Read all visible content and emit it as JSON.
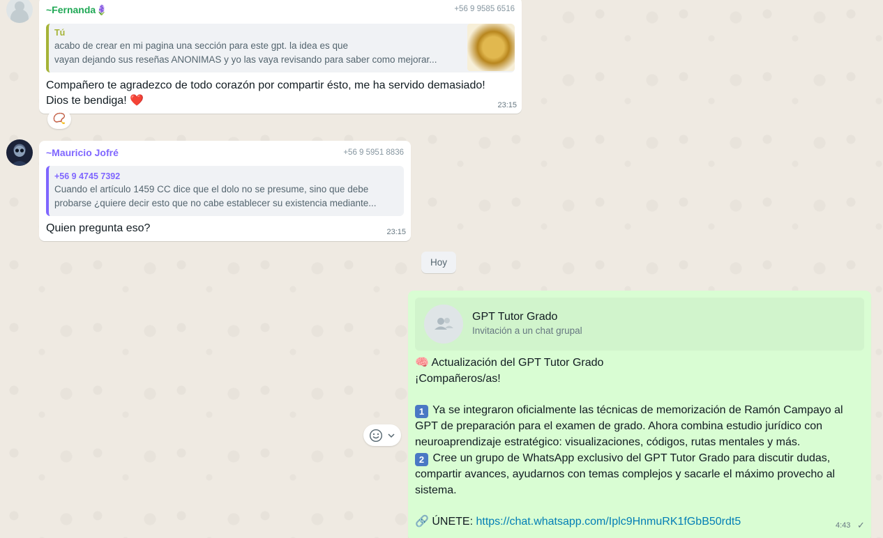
{
  "messages": [
    {
      "sender": "~Fernanda🪻",
      "phone": "+56 9 9585 6516",
      "quote_name": "Tú",
      "quote_line1": "acabo de crear en mi pagina una sección para este gpt. la idea es que",
      "quote_line2": "vayan dejando sus reseñas ANONIMAS y yo las vaya revisando para saber como mejorar...",
      "text_line1": "Compañero te agradezco de todo corazón por compartir ésto, me ha servido demasiado!",
      "text_line2": "Dios te bendiga! ❤️",
      "time": "23:15",
      "reaction": "📿"
    },
    {
      "sender": "~Mauricio Jofré",
      "phone": "+56 9 5951 8836",
      "quote_name": "+56 9 4745 7392",
      "quote_line1": "Cuando el artículo 1459 CC dice que el dolo no se presume, sino que debe",
      "quote_line2": "probarse ¿quiere decir esto que no cabe establecer su existencia mediante...",
      "text": "Quien pregunta eso?",
      "time": "23:15"
    }
  ],
  "date_chip": "Hoy",
  "outgoing": {
    "invite_title": "GPT Tutor Grado",
    "invite_subtitle": "Invitación a un chat grupal",
    "line_heading": "🧠 Actualización del GPT Tutor Grado",
    "line_greeting": "¡Compañeros/as!",
    "item1_num": "1",
    "item1_line1": "Ya se integraron oficialmente las técnicas de memorización de Ramón Campayo al",
    "item1_line2": "GPT de preparación para el examen de grado. Ahora combina estudio jurídico con",
    "item1_line3": "neuroaprendizaje estratégico: visualizaciones, códigos, rutas mentales y más.",
    "item2_num": "2",
    "item2_line1": "Cree un grupo de WhatsApp exclusivo del GPT Tutor Grado para discutir dudas,",
    "item2_line2": "compartir avances, ayudarnos con temas complejos y sacarle el máximo provecho al",
    "item2_line3": "sistema.",
    "join_label": "🔗 ÚNETE: ",
    "join_link": "https://chat.whatsapp.com/Iplc9HnmuRK1fGbB50rdt5",
    "time": "4:43",
    "status": "✓"
  },
  "icons": {
    "react": "smiley-icon",
    "chevron": "chevron-down-icon",
    "group": "group-icon"
  },
  "colors": {
    "fernanda": "#1fa855",
    "mauricio": "#7f66ff",
    "quote_you": "#a5b337",
    "link": "#027eb5",
    "outgoing_bg": "#d9fdd3"
  }
}
